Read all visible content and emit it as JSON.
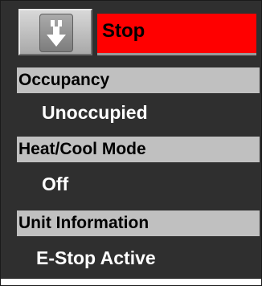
{
  "status": {
    "label": "Stop",
    "color": "#ff0000",
    "button_icon": "download-arrow-icon"
  },
  "sections": [
    {
      "header": "Occupancy",
      "value": "Unoccupied"
    },
    {
      "header": "Heat/Cool Mode",
      "value": "Off"
    },
    {
      "header": "Unit Information",
      "value": "E-Stop Active"
    }
  ]
}
